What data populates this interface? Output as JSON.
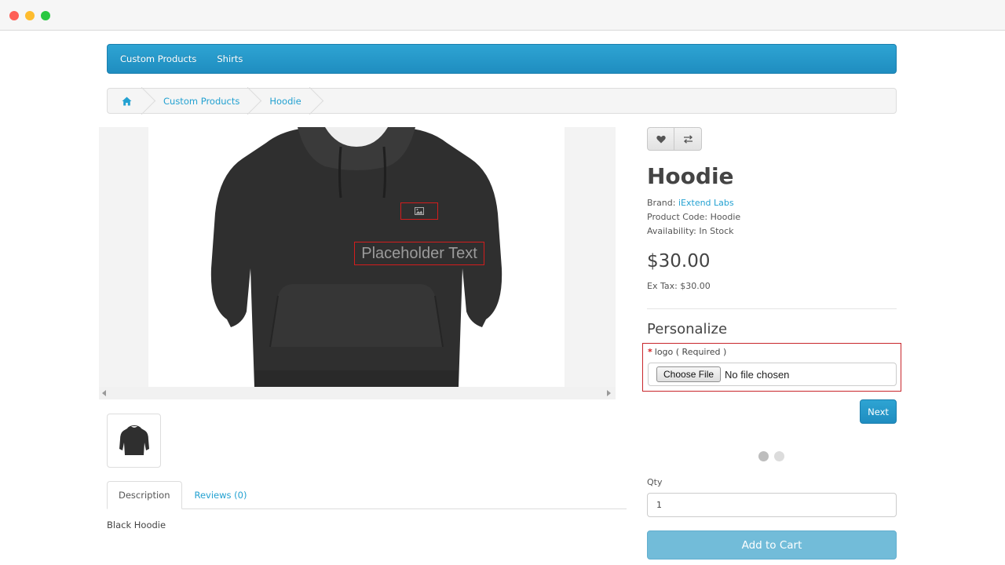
{
  "nav": {
    "items": [
      {
        "label": "Custom Products"
      },
      {
        "label": "Shirts"
      }
    ]
  },
  "breadcrumb": {
    "home_icon": "home-icon",
    "items": [
      {
        "label": "Custom Products"
      },
      {
        "label": "Hoodie"
      }
    ]
  },
  "preview": {
    "image_icon": "image-placeholder-icon",
    "placeholder_text": "Placeholder Text"
  },
  "actions": {
    "wishlist_icon": "heart-icon",
    "compare_icon": "compare-arrows-icon"
  },
  "product": {
    "title": "Hoodie",
    "brand_label": "Brand:",
    "brand_value": "iExtend Labs",
    "code_label": "Product Code:",
    "code_value": "Hoodie",
    "availability_label": "Availability:",
    "availability_value": "In Stock",
    "price": "$30.00",
    "ex_tax": "Ex Tax: $30.00"
  },
  "personalize": {
    "title": "Personalize",
    "required_mark": "*",
    "option_label": "logo ( Required )",
    "choose_file_label": "Choose File",
    "no_file_text": "No file chosen",
    "next_label": "Next"
  },
  "purchase": {
    "qty_label": "Qty",
    "qty_value": "1",
    "add_to_cart_label": "Add to Cart"
  },
  "tabs": [
    {
      "label": "Description"
    },
    {
      "label": "Reviews (0)"
    }
  ],
  "description_text": "Black Hoodie",
  "colors": {
    "accent": "#23a1d1",
    "highlight_border": "#d31d1d",
    "add_to_cart_bg": "#72bcd9"
  }
}
